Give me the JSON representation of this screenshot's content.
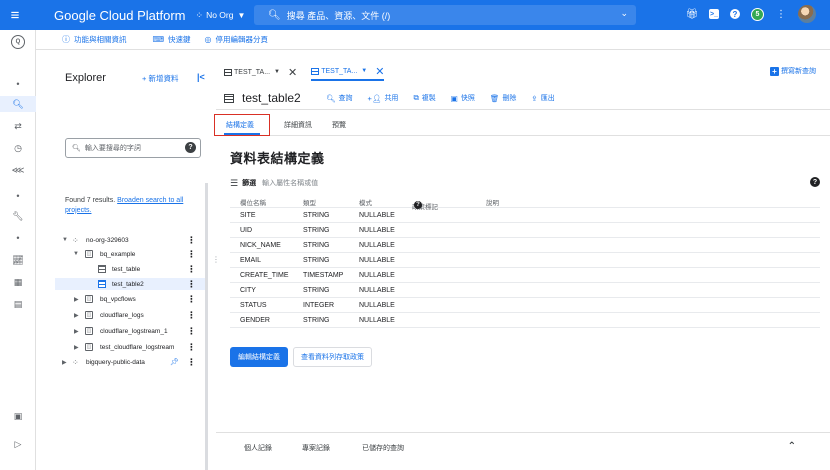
{
  "topbar": {
    "app_title": "Google Cloud Platform",
    "org_name": "No Org",
    "search_placeholder": "搜尋 產品、資源、文件 (/)"
  },
  "subbar": {
    "items": [
      "功能與相關資訊",
      "快速鍵",
      "停用編輯器分頁"
    ]
  },
  "explorer": {
    "title": "Explorer",
    "add_label": "+ 新增資料",
    "collapse_label": "|<",
    "search_placeholder": "輸入要搜尋的字詞",
    "found_text": "Found 7 results.",
    "found_link": "Broaden search to all projects.",
    "tree": [
      {
        "label": "no-org-329603",
        "type": "project"
      },
      {
        "label": "bq_example",
        "type": "dataset"
      },
      {
        "label": "test_table",
        "type": "table"
      },
      {
        "label": "test_table2",
        "type": "table"
      },
      {
        "label": "bq_vpcflows",
        "type": "dataset"
      },
      {
        "label": "cloudflare_logs",
        "type": "dataset"
      },
      {
        "label": "cloudflare_logstream_1",
        "type": "dataset"
      },
      {
        "label": "test_cloudflare_logstream",
        "type": "dataset"
      },
      {
        "label": "bigquery-public-data",
        "type": "project"
      }
    ]
  },
  "query_tabs": [
    {
      "label": "TEST_TA..."
    },
    {
      "label": "TEST_TA..."
    }
  ],
  "new_query_label": "撰寫新查詢",
  "table": {
    "name": "test_table2",
    "actions": [
      "查詢",
      "共用",
      "複製",
      "快照",
      "刪除",
      "匯出"
    ]
  },
  "detail_tabs": [
    "結構定義",
    "詳細資訊",
    "預覽"
  ],
  "section_title": "資料表結構定義",
  "filter": {
    "label": "篩選",
    "placeholder": "輸入屬性名稱或值"
  },
  "schema": {
    "headers": [
      "欄位名稱",
      "類型",
      "模式",
      "政策標記",
      "說明"
    ],
    "rows": [
      {
        "name": "SITE",
        "type": "STRING",
        "mode": "NULLABLE"
      },
      {
        "name": "UID",
        "type": "STRING",
        "mode": "NULLABLE"
      },
      {
        "name": "NICK_NAME",
        "type": "STRING",
        "mode": "NULLABLE"
      },
      {
        "name": "EMAIL",
        "type": "STRING",
        "mode": "NULLABLE"
      },
      {
        "name": "CREATE_TIME",
        "type": "TIMESTAMP",
        "mode": "NULLABLE"
      },
      {
        "name": "CITY",
        "type": "STRING",
        "mode": "NULLABLE"
      },
      {
        "name": "STATUS",
        "type": "INTEGER",
        "mode": "NULLABLE"
      },
      {
        "name": "GENDER",
        "type": "STRING",
        "mode": "NULLABLE"
      }
    ]
  },
  "buttons": {
    "edit_schema": "編輯結構定義",
    "view_policies": "查看資料列存取政策"
  },
  "bottom_tabs": [
    "個人記錄",
    "專案記錄",
    "已儲存的查詢"
  ],
  "colors": {
    "accent": "#1a73e8",
    "highlight_box": "#d93025"
  }
}
